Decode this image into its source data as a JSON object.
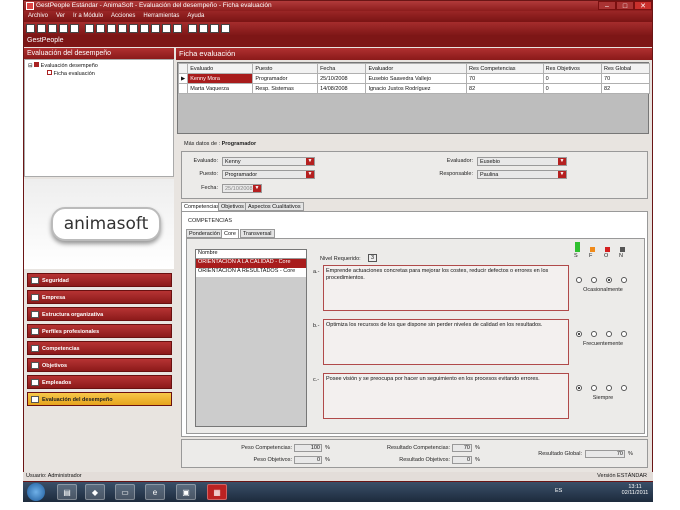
{
  "window": {
    "title": "GestPeople Estándar - AnimaSoft - Evaluación del desempeño - Ficha evaluación"
  },
  "menu": [
    "Archivo",
    "Ver",
    "Ir a Módulo",
    "Acciones",
    "Herramientas",
    "Ayuda"
  ],
  "app_name": "GestPeople",
  "left": {
    "header": "Evaluación del desempeño",
    "tree": [
      "Evaluación desempeño",
      "Ficha evaluación"
    ],
    "logo": "animasoft",
    "nav": [
      "Seguridad",
      "Empresa",
      "Estructura organizativa",
      "Perfiles profesionales",
      "Competencias",
      "Objetivos",
      "Empleados",
      "Evaluación del desempeño"
    ]
  },
  "main": {
    "header": "Ficha evaluación",
    "grid": {
      "columns": [
        "Evaluado",
        "Puesto",
        "Fecha",
        "Evaluador",
        "Res Competencias",
        "Res Objetivos",
        "Res Global"
      ],
      "rows": [
        [
          "Kenny Mora",
          "Programador",
          "25/10/2008",
          "Eusebio Saavedra Vallejo",
          "70",
          "0",
          "70"
        ],
        [
          "Marta Vaquerza",
          "Resp. Sistemas",
          "14/08/2008",
          "Ignacio Justos Rodríguez",
          "82",
          "0",
          "82"
        ]
      ]
    },
    "more_label": "Más datos de :",
    "more_value": "Programador",
    "form": {
      "evaluado_label": "Evaluado:",
      "evaluado": "Kenny",
      "puesto_label": "Puesto:",
      "puesto": "Programador",
      "fecha_label": "Fecha:",
      "fecha": "25/10/2008",
      "evaluador_label": "Evaluador:",
      "evaluador": "Eusebio",
      "responsable_label": "Responsable:",
      "responsable": "Paulina"
    },
    "tabs": [
      "Competencias",
      "Objetivos",
      "Aspectos Cualitativos"
    ],
    "group": "COMPETENCIAS",
    "subtabs": [
      "Ponderación",
      "Core",
      "Transversal"
    ],
    "list": {
      "header": "Nombre",
      "items": [
        "ORIENTACION A LA CALIDAD - Core",
        "ORIENTACION A RESULTADOS - Core"
      ]
    },
    "nivel_label": "Nivel Requerido:",
    "nivel": "3",
    "scale": [
      "S",
      "F",
      "O",
      "N"
    ],
    "scale_colors": [
      "#2fbf2f",
      "#f08a1a",
      "#d42020",
      "#555555"
    ],
    "behaviors": [
      {
        "letter": "a.-",
        "text": "Emprende actuaciones concretas para mejorar los costes, reducir defectos o errores en los procedimientos.",
        "freq": "Ocasionalmente"
      },
      {
        "letter": "b.-",
        "text": "Optimiza los recursos de los que dispone sin perder niveles de calidad en los resultados.",
        "freq": "Frecuentemente"
      },
      {
        "letter": "c.-",
        "text": "Posee visión y se preocupa por hacer un seguimiento en los procesos evitando errores.",
        "freq": "Siempre"
      }
    ],
    "totals": {
      "peso_comp_label": "Peso Competencias:",
      "peso_comp": "100",
      "peso_obj_label": "Peso Objetivos:",
      "peso_obj": "0",
      "res_comp_label": "Resultado Competencias:",
      "res_comp": "70",
      "res_obj_label": "Resultado Objetivos:",
      "res_obj": "0",
      "res_global_label": "Resultado Global:",
      "res_global": "70",
      "pct": "%"
    }
  },
  "status": {
    "user": "Usuario: Administrador",
    "version": "Versión ESTÁNDAR"
  },
  "taskbar": {
    "lang": "ES",
    "time": "13:11",
    "date": "02/11/2011"
  }
}
